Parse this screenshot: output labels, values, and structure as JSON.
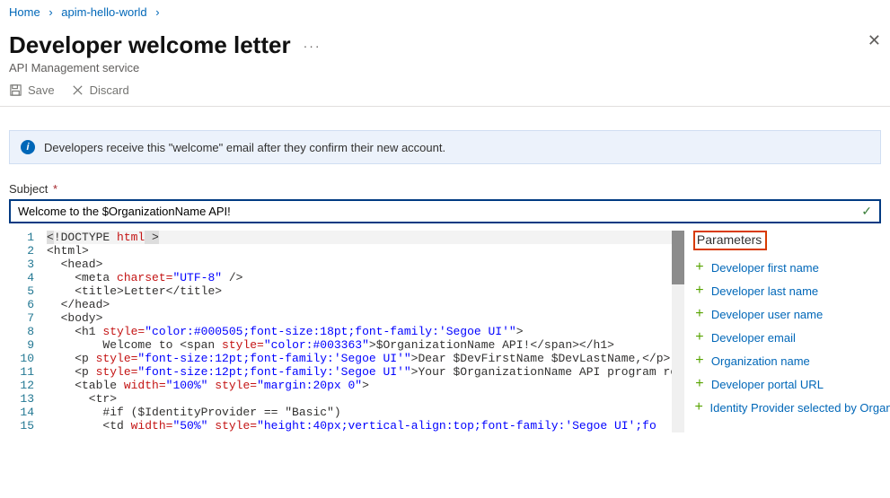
{
  "breadcrumb": {
    "home": "Home",
    "sep": "›",
    "item": "apim-hello-world"
  },
  "header": {
    "title": "Developer welcome letter",
    "dots": "···",
    "subtitle": "API Management service",
    "close": "✕"
  },
  "toolbar": {
    "save": "Save",
    "discard": "Discard"
  },
  "banner": {
    "text": "Developers receive this \"welcome\" email after they confirm their new account."
  },
  "form": {
    "subject_label": "Subject",
    "req": "*",
    "subject_value": "Welcome to the $OrganizationName API!",
    "check": "✓"
  },
  "code": {
    "l1a": "<",
    "l1b": "!DOCTYPE ",
    "l1c": "html",
    "l1d": " >",
    "l2": "<html>",
    "l3": "  <head>",
    "l4a": "    <meta ",
    "l4b": "charset=",
    "l4c": "\"UTF-8\"",
    "l4d": " />",
    "l5a": "    <title>",
    "l5b": "Letter",
    "l5c": "</title>",
    "l6": "  </head>",
    "l7": "  <body>",
    "l8a": "    <h1 ",
    "l8b": "style=",
    "l8c": "\"color:#000505;font-size:18pt;font-family:'Segoe UI'\"",
    "l8d": ">",
    "l9a": "        Welcome to <span ",
    "l9b": "style=",
    "l9c": "\"color:#003363\"",
    "l9d": ">$OrganizationName API!</span></h1>",
    "l10a": "    <p ",
    "l10b": "style=",
    "l10c": "\"font-size:12pt;font-family:'Segoe UI'\"",
    "l10d": ">Dear $DevFirstName $DevLastName,</p>",
    "l11a": "    <p ",
    "l11b": "style=",
    "l11c": "\"font-size:12pt;font-family:'Segoe UI'\"",
    "l11d": ">Your $OrganizationName API program reg",
    "l12a": "    <table ",
    "l12b": "width=",
    "l12c": "\"100%\"",
    "l12d": " ",
    "l12e": "style=",
    "l12f": "\"margin:20px 0\"",
    "l12g": ">",
    "l13": "      <tr>",
    "l14": "        #if ($IdentityProvider == \"Basic\")",
    "l15a": "        <td ",
    "l15b": "width=",
    "l15c": "\"50%\"",
    "l15d": " ",
    "l15e": "style=",
    "l15f": "\"height:40px;vertical-align:top;font-family:'Segoe UI';fo",
    "nums": {
      "n1": "1",
      "n2": "2",
      "n3": "3",
      "n4": "4",
      "n5": "5",
      "n6": "6",
      "n7": "7",
      "n8": "8",
      "n9": "9",
      "n10": "10",
      "n11": "11",
      "n12": "12",
      "n13": "13",
      "n14": "14",
      "n15": "15"
    }
  },
  "params": {
    "title": "Parameters",
    "items": {
      "p0": "Developer first name",
      "p1": "Developer last name",
      "p2": "Developer user name",
      "p3": "Developer email",
      "p4": "Organization name",
      "p5": "Developer portal URL",
      "p6": "Identity Provider selected by Organization"
    }
  }
}
